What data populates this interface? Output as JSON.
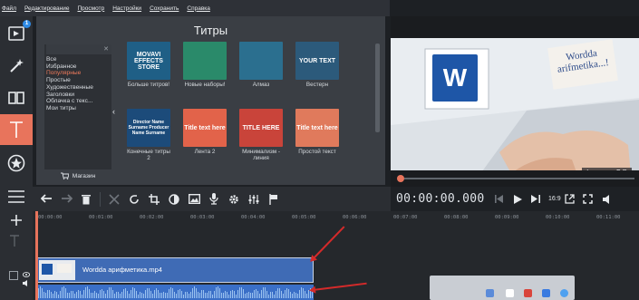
{
  "menu": [
    "Файл",
    "Редактирование",
    "Просмотр",
    "Настройки",
    "Сохранить",
    "Справка"
  ],
  "rail": {
    "badge": "1",
    "tools": [
      "import-icon",
      "magic-wand-icon",
      "transitions-icon",
      "titles-icon",
      "stickers-icon",
      "more-icon"
    ],
    "active_tool": "titles-icon"
  },
  "titles_panel": {
    "heading": "Титры",
    "categories": [
      "Все",
      "Избранное",
      "Популярные",
      "Простые",
      "Художественные",
      "Заголовки",
      "Облачка с текс...",
      "Мои титры"
    ],
    "selected_category": "Популярные",
    "store_label": "Магазин",
    "tiles": [
      {
        "thumb_text": "MOVAVI EFFECTS STORE",
        "caption": "Больше титров!",
        "color": "#1f5f86"
      },
      {
        "thumb_text": "",
        "caption": "Новые наборы!",
        "color": "#2a8a6a"
      },
      {
        "thumb_text": "",
        "caption": "Алмаз",
        "color": "#2b6f8f"
      },
      {
        "thumb_text": "YOUR TEXT",
        "caption": "Вестерн",
        "color": "#2c5a7b"
      },
      {
        "thumb_text": "Director Name Surname Producer Name Surname",
        "caption": "Конечные титры 2",
        "color": "#1c4b7a"
      },
      {
        "thumb_text": "Title text here",
        "caption": "Лента 2",
        "color": "#e2634a"
      },
      {
        "thumb_text": "TITLE HERE",
        "caption": "Минимализм - линия",
        "color": "#c9443a"
      },
      {
        "thumb_text": "Title text here",
        "caption": "Простой текст",
        "color": "#e07a5c"
      }
    ]
  },
  "preview": {
    "note_text": "Wordda arifmetika...!",
    "name_tag": "Ismanova O.D",
    "word_letter": "W"
  },
  "toolbar": [
    "undo-icon",
    "redo-icon",
    "delete-icon",
    "cut-icon",
    "rotate-icon",
    "crop-icon",
    "color-adjust-icon",
    "image-icon",
    "audio-icon",
    "settings-icon",
    "equalizer-icon",
    "flag-icon"
  ],
  "transport": {
    "timecode": "00:00:00.000",
    "aspect": "16:9"
  },
  "timeline": {
    "ruler": [
      "00:00:00",
      "00:01:00",
      "00:02:00",
      "00:03:00",
      "00:04:00",
      "00:05:00",
      "00:06:00",
      "00:07:00",
      "00:08:00",
      "00:09:00",
      "00:10:00",
      "00:11:00"
    ],
    "clip_name": "Wordda арифметика.mp4"
  },
  "colors": {
    "accent": "#e8745c",
    "clip": "#3f6bb5",
    "arrow": "#d42a2a"
  }
}
